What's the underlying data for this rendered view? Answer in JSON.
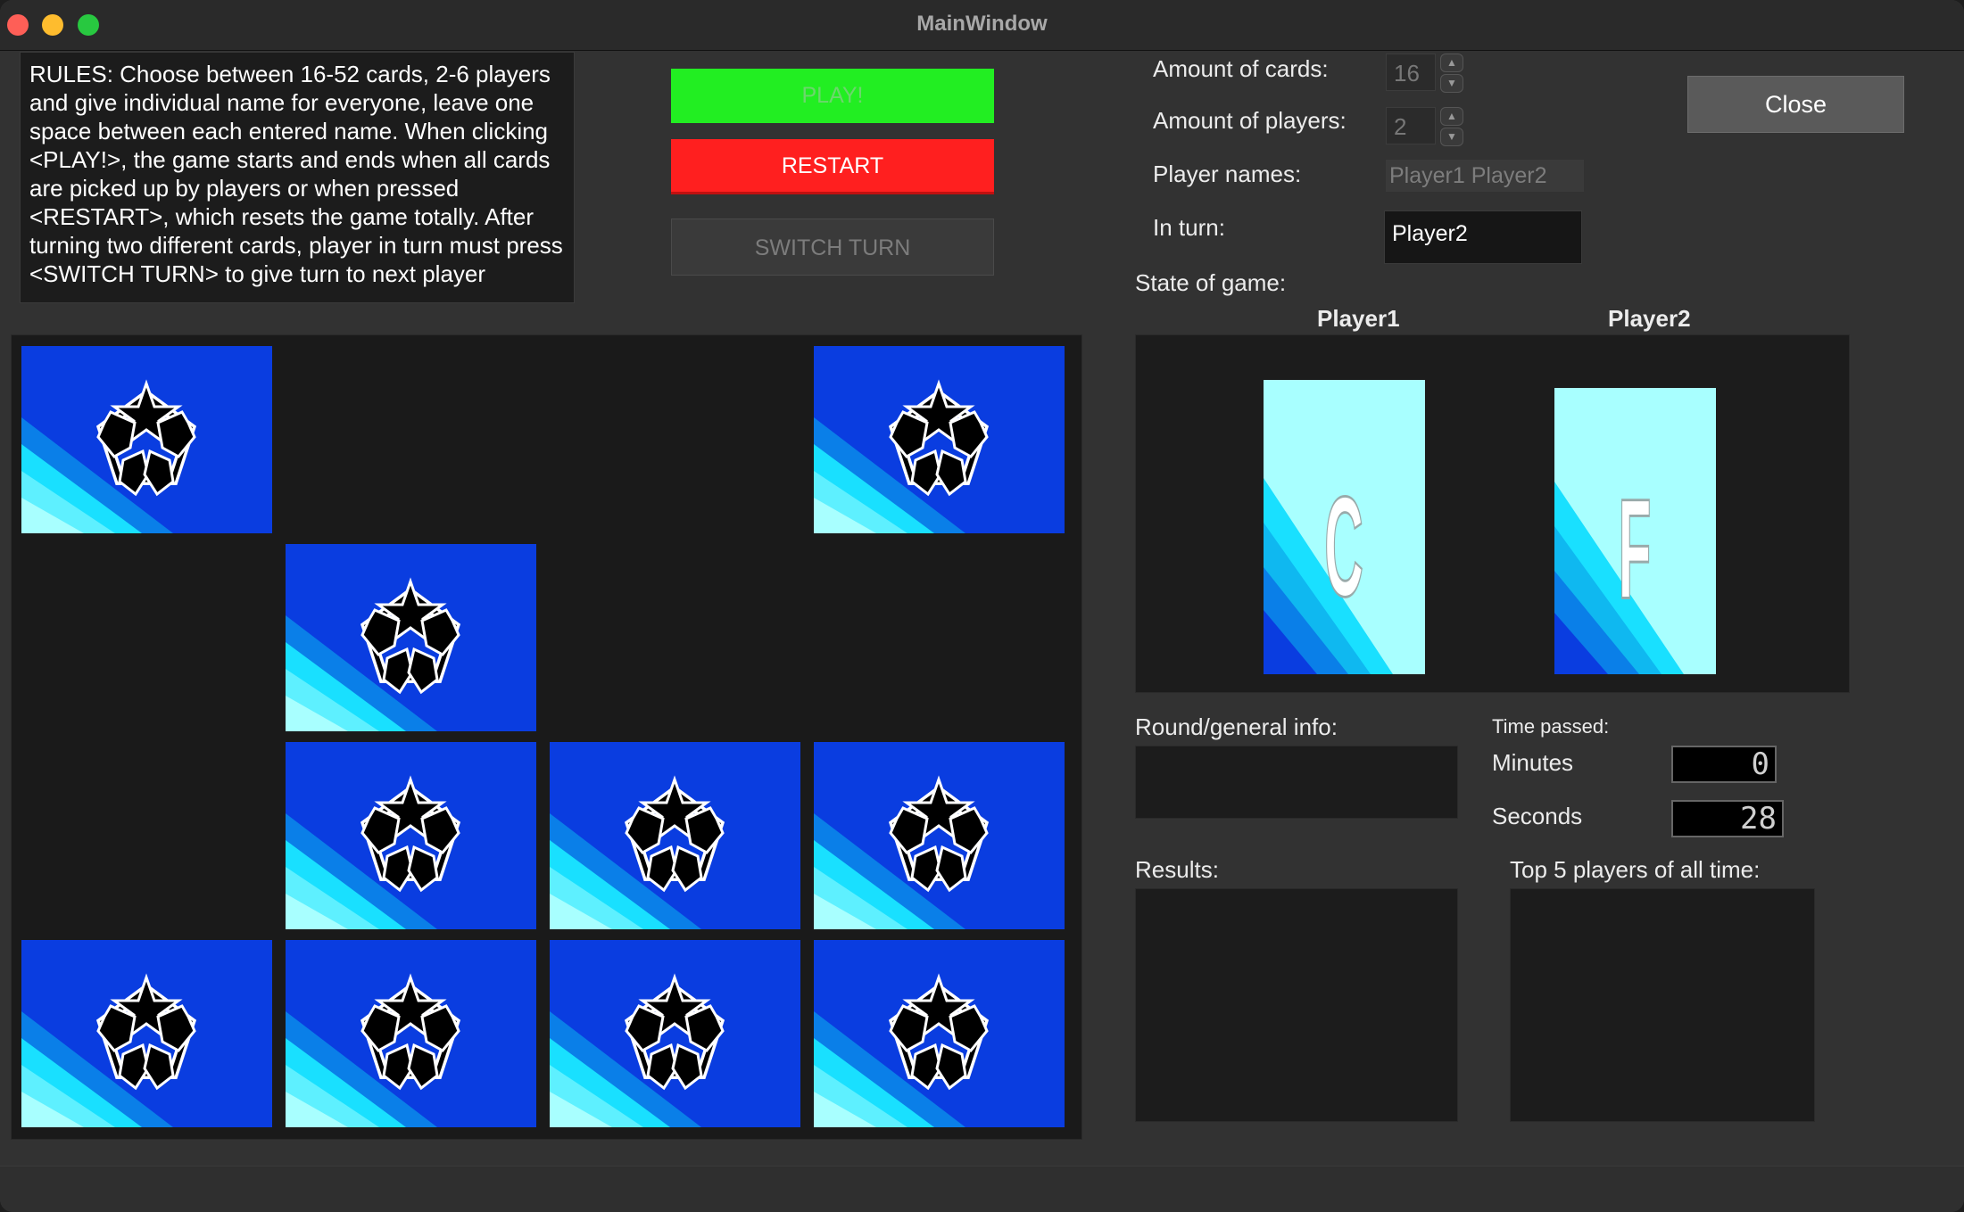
{
  "window": {
    "title": "MainWindow"
  },
  "rules": {
    "text": "RULES: Choose between 16-52 cards, 2-6 players and give individual name for everyone, leave one space between each entered name.   When clicking <PLAY!>, the game starts and ends when all cards are picked up by players or when pressed <RESTART>, which resets the game totally. After turning two different cards, player in turn must press <SWITCH TURN> to give turn to next player"
  },
  "buttons": {
    "play": "PLAY!",
    "restart": "RESTART",
    "switch_turn": "SWITCH TURN",
    "close": "Close"
  },
  "settings": {
    "cards_label": "Amount of cards:",
    "cards_value": "16",
    "players_label": "Amount of players:",
    "players_value": "2",
    "names_label": "Player names:",
    "names_value": "Player1 Player2",
    "turn_label": "In turn:",
    "turn_value": "Player2"
  },
  "state": {
    "label": "State of game:",
    "players": [
      {
        "name": "Player1",
        "card_letter": "C"
      },
      {
        "name": "Player2",
        "card_letter": "F"
      }
    ]
  },
  "info": {
    "round_label": "Round/general info:",
    "round_value": ""
  },
  "timer": {
    "label": "Time passed:",
    "minutes_label": "Minutes",
    "minutes_value": "0",
    "seconds_label": "Seconds",
    "seconds_value": "28"
  },
  "results": {
    "label": "Results:",
    "top5_label": "Top 5 players of all time:"
  },
  "board": {
    "grid": [
      [
        "back",
        "empty",
        "empty",
        "back"
      ],
      [
        "empty",
        "back",
        "empty",
        "empty"
      ],
      [
        "empty",
        "back",
        "back",
        "back"
      ],
      [
        "back",
        "back",
        "back",
        "back"
      ]
    ]
  },
  "colors": {
    "card_blue": "#0a3de0",
    "card_cyan": "#19e0ff",
    "card_light": "#a8ffff",
    "play_green": "#22ee22",
    "restart_red": "#ff1f1f"
  }
}
